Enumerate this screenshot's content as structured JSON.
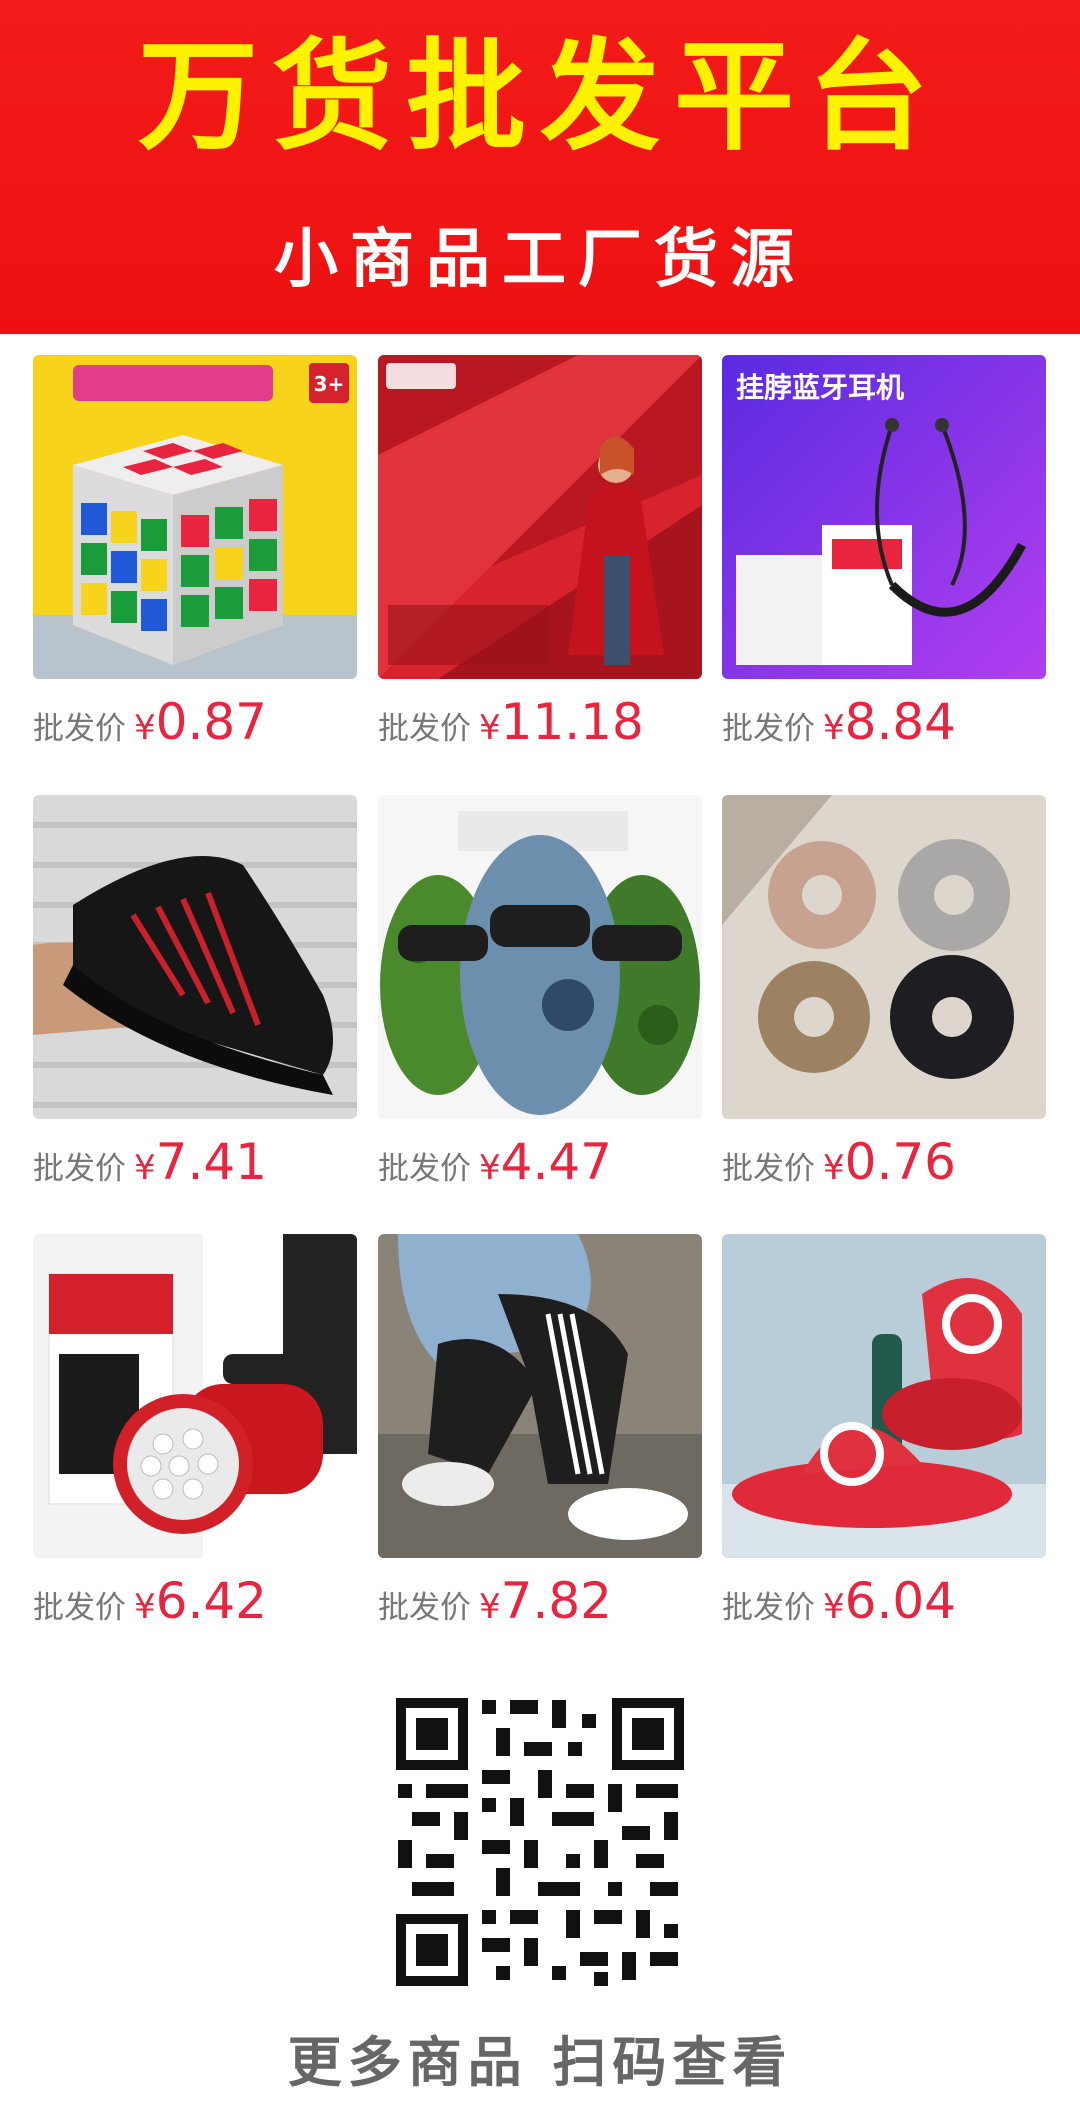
{
  "banner": {
    "title": "万货批发平台",
    "subtitle": "小商品工厂货源"
  },
  "products": [
    {
      "label": "批发价",
      "currency": "¥",
      "price": "0.87",
      "icon": "rubiks-cube-image",
      "tag": "3+"
    },
    {
      "label": "批发价",
      "currency": "¥",
      "price": "11.18",
      "icon": "red-fabric-image"
    },
    {
      "label": "批发价",
      "currency": "¥",
      "price": "8.84",
      "icon": "bluetooth-earphones-image",
      "caption": "挂脖蓝牙耳机"
    },
    {
      "label": "批发价",
      "currency": "¥",
      "price": "7.41",
      "icon": "sneaker-image"
    },
    {
      "label": "批发价",
      "currency": "¥",
      "price": "4.47",
      "icon": "camo-balaclava-image"
    },
    {
      "label": "批发价",
      "currency": "¥",
      "price": "0.76",
      "icon": "hair-scrunchies-image"
    },
    {
      "label": "批发价",
      "currency": "¥",
      "price": "6.42",
      "icon": "flashlight-image"
    },
    {
      "label": "批发价",
      "currency": "¥",
      "price": "7.82",
      "icon": "jogger-pants-image"
    },
    {
      "label": "批发价",
      "currency": "¥",
      "price": "6.04",
      "icon": "red-slipper-image"
    }
  ],
  "footer": {
    "text": "更多商品 扫码查看"
  },
  "colors": {
    "banner_bg": "#f01515",
    "title_color": "#fff200",
    "price_color": "#e8243e",
    "label_color": "#777777"
  }
}
